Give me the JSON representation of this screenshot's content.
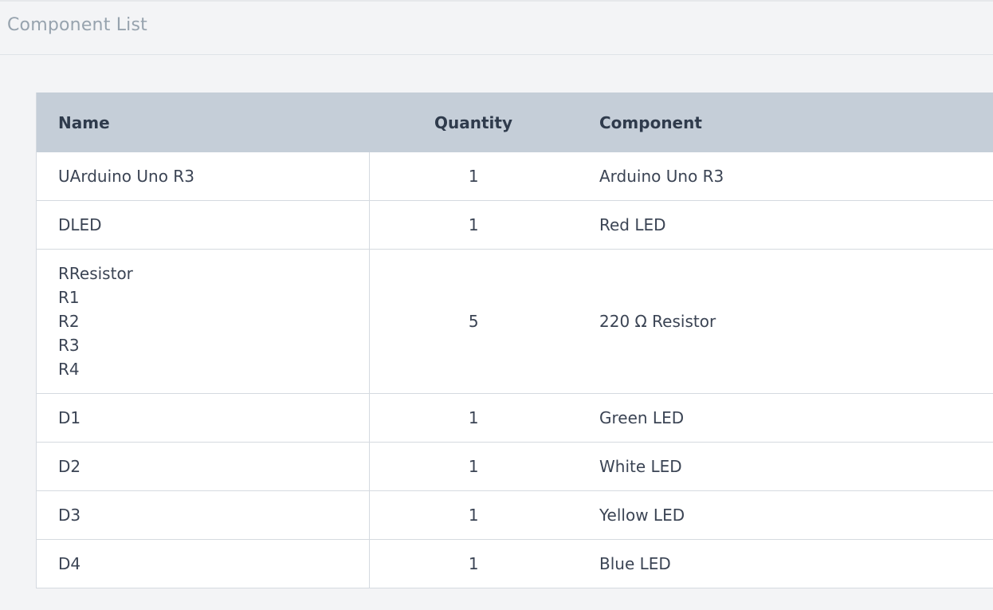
{
  "page": {
    "title": "Component List"
  },
  "table": {
    "headers": {
      "name": "Name",
      "quantity": "Quantity",
      "component": "Component"
    },
    "rows": [
      {
        "name_lines": [
          "UArduino Uno R3"
        ],
        "quantity": "1",
        "component": "Arduino Uno R3"
      },
      {
        "name_lines": [
          "DLED"
        ],
        "quantity": "1",
        "component": "Red LED"
      },
      {
        "name_lines": [
          "RResistor",
          "R1",
          "R2",
          "R3",
          "R4"
        ],
        "quantity": "5",
        "component": "220 Ω Resistor"
      },
      {
        "name_lines": [
          "D1"
        ],
        "quantity": "1",
        "component": "Green LED"
      },
      {
        "name_lines": [
          "D2"
        ],
        "quantity": "1",
        "component": "White LED"
      },
      {
        "name_lines": [
          "D3"
        ],
        "quantity": "1",
        "component": "Yellow LED"
      },
      {
        "name_lines": [
          "D4"
        ],
        "quantity": "1",
        "component": "Blue LED"
      }
    ]
  },
  "colors": {
    "background": "#f3f4f6",
    "header_row": "#c5ced8",
    "title_text": "#97a3ae",
    "border": "#d5dae0"
  }
}
